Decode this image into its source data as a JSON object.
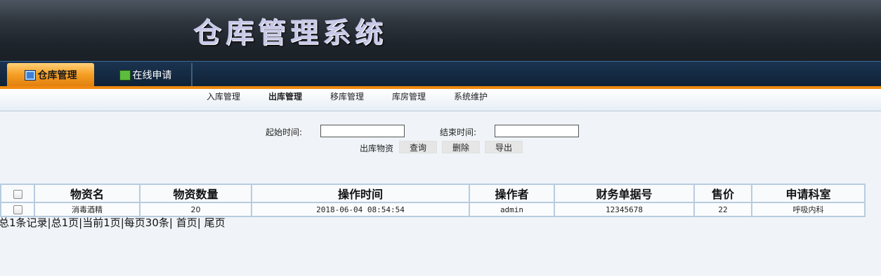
{
  "app": {
    "title": "仓库管理系统"
  },
  "nav": {
    "tabs": [
      {
        "label": "仓库管理",
        "icon": "monitor-icon"
      },
      {
        "label": "在线申请",
        "icon": "book-icon"
      }
    ]
  },
  "subnav": {
    "items": [
      {
        "label": "入库管理"
      },
      {
        "label": "出库管理"
      },
      {
        "label": "移库管理"
      },
      {
        "label": "库房管理"
      },
      {
        "label": "系统维护"
      }
    ]
  },
  "filter": {
    "start_label": "起始时间:",
    "start_value": "",
    "end_label": "结束时间:",
    "end_value": "",
    "section_label": "出库物资",
    "query_label": "查询",
    "delete_label": "删除",
    "export_label": "导出"
  },
  "table": {
    "headers": [
      "物资名",
      "物资数量",
      "操作时间",
      "操作者",
      "财务单据号",
      "售价",
      "申请科室"
    ],
    "rows": [
      [
        "消毒酒精",
        "20",
        "2018-06-04 08:54:54",
        "admin",
        "12345678",
        "22",
        "呼吸内科"
      ]
    ]
  },
  "pager": {
    "summary": "总1条记录|总1页|当前1页|每页30条|",
    "first_label": "首页",
    "sep": "|",
    "last_label": "尾页"
  },
  "colors": {
    "accent": "#f08a10",
    "nav_bg": "#13263c",
    "header_bg": "#2f363e"
  }
}
